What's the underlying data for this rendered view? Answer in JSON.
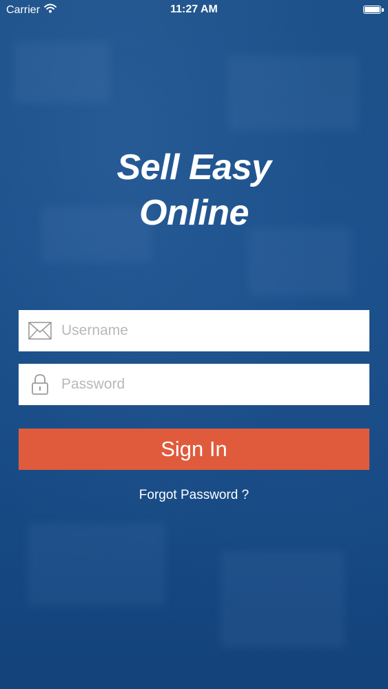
{
  "status_bar": {
    "carrier": "Carrier",
    "time": "11:27 AM",
    "icons": [
      "wifi-icon",
      "battery-icon"
    ]
  },
  "app": {
    "title_line1": "Sell Easy",
    "title_line2": "Online"
  },
  "login_form": {
    "username_placeholder": "Username",
    "username_value": "",
    "password_placeholder": "Password",
    "password_value": "",
    "username_icon": "envelope-icon",
    "password_icon": "lock-icon",
    "sign_in_label": "Sign In",
    "forgot_password_label": "Forgot Password ?"
  },
  "colors": {
    "background": "#1a4f8a",
    "field_background": "#ffffff",
    "placeholder": "#b8b8b8",
    "icon_gray": "#9a9a9a",
    "accent": "#e05b3c",
    "text_light": "#ffffff"
  }
}
